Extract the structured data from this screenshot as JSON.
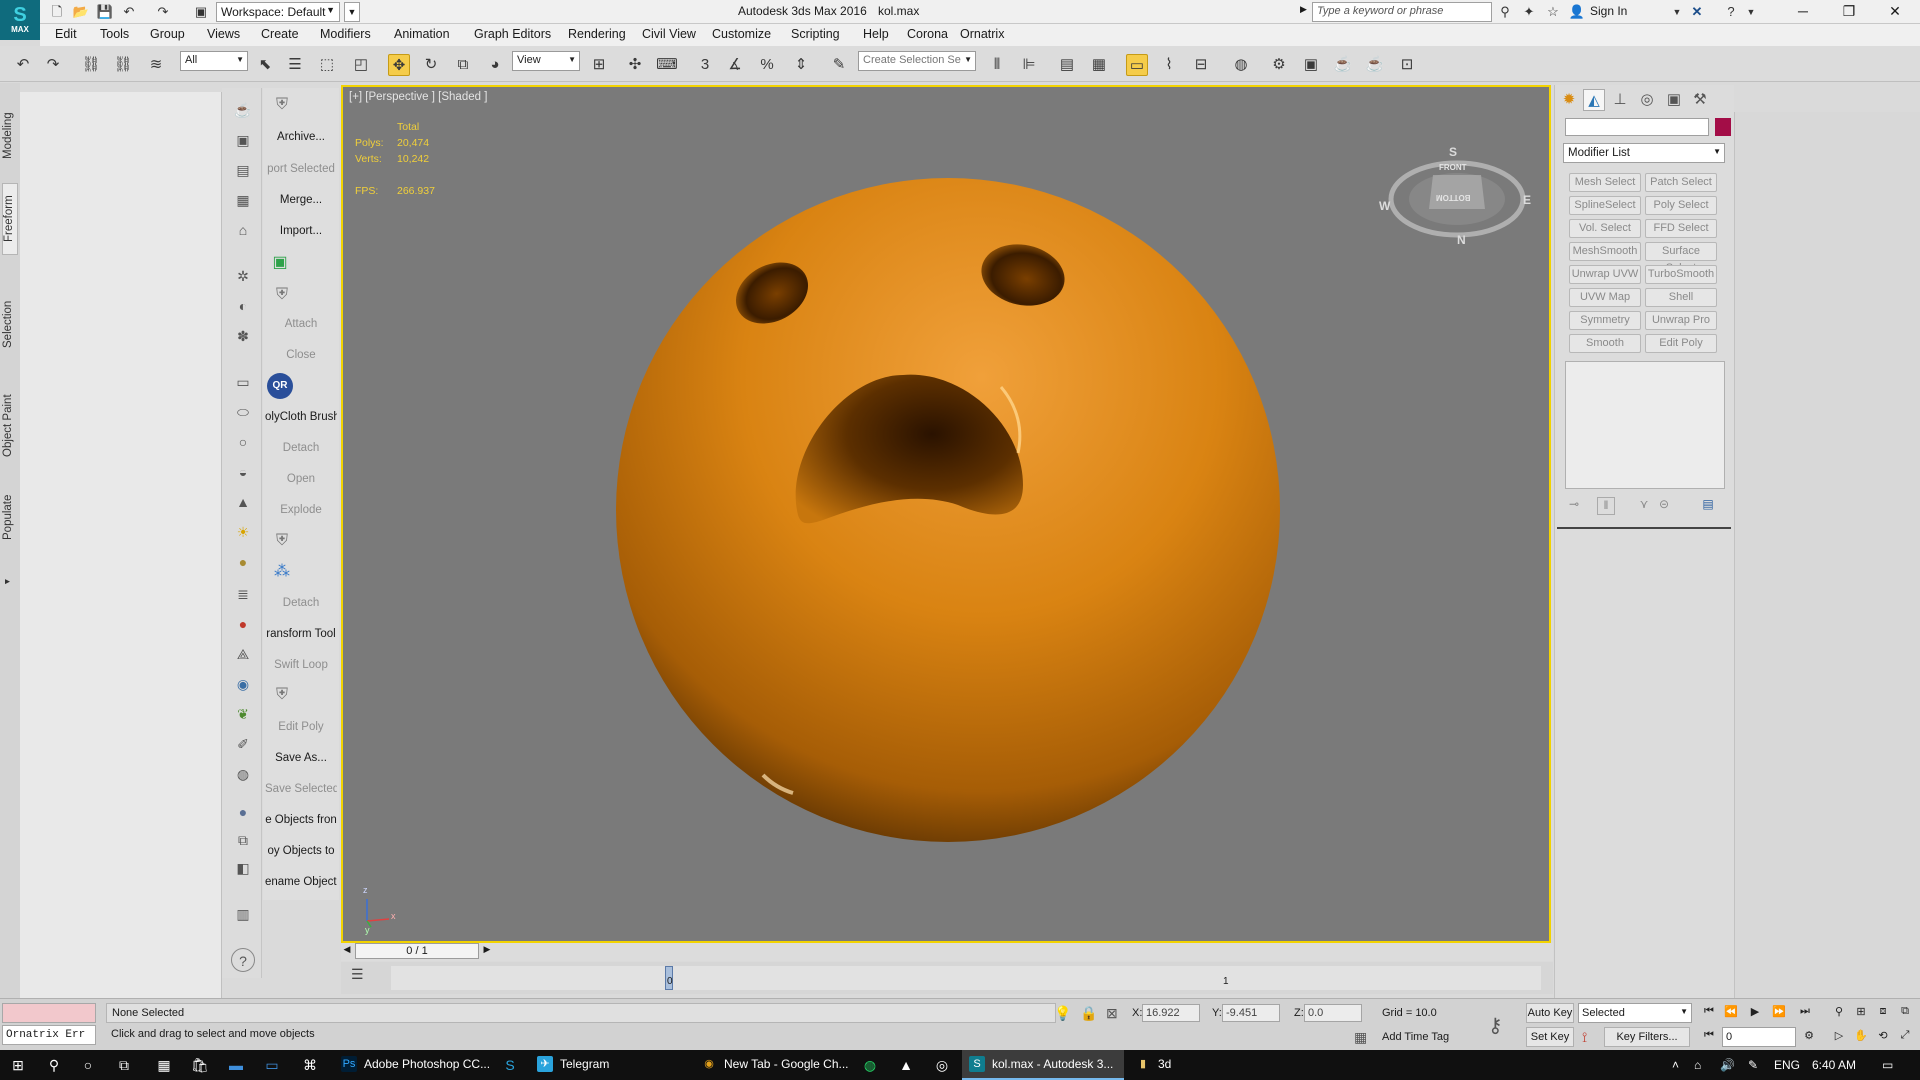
{
  "window": {
    "app_title": "Autodesk 3ds Max 2016",
    "file_name": "kol.max",
    "workspace": "Workspace: Default",
    "search_placeholder": "Type a keyword or phrase",
    "sign_in": "Sign In",
    "logo_letter": "S",
    "logo_sub": "MAX"
  },
  "menu": [
    "Edit",
    "Tools",
    "Group",
    "Views",
    "Create",
    "Modifiers",
    "Animation",
    "Graph Editors",
    "Rendering",
    "Civil View",
    "Customize",
    "Scripting",
    "Help",
    "Corona",
    "Ornatrix"
  ],
  "toolbar": {
    "filter_value": "All",
    "refcoord_value": "View",
    "named_selection_placeholder": "Create Selection Se",
    "snap_label": "3"
  },
  "side_tabs": [
    "Modeling",
    "Freeform",
    "Selection",
    "Object Paint",
    "Populate"
  ],
  "command_items": [
    {
      "label": "Archive...",
      "disabled": false
    },
    {
      "label": "port Selected",
      "disabled": true
    },
    {
      "label": "Merge...",
      "disabled": false
    },
    {
      "label": "Import...",
      "disabled": false
    },
    {
      "label": "Attach",
      "disabled": true
    },
    {
      "label": "Close",
      "disabled": true
    },
    {
      "label": "olyCloth Brush",
      "disabled": false
    },
    {
      "label": "Detach",
      "disabled": true
    },
    {
      "label": "Open",
      "disabled": true
    },
    {
      "label": "Explode",
      "disabled": true
    },
    {
      "label": "Detach",
      "disabled": true
    },
    {
      "label": "ransform Tool",
      "disabled": false
    },
    {
      "label": "Swift Loop",
      "disabled": true
    },
    {
      "label": "Edit Poly",
      "disabled": true
    },
    {
      "label": "Save As...",
      "disabled": false
    },
    {
      "label": "Save Selected",
      "disabled": true
    },
    {
      "label": "e Objects fron",
      "disabled": false
    },
    {
      "label": "oy Objects to",
      "disabled": false
    },
    {
      "label": "ename Objects",
      "disabled": false
    }
  ],
  "command_icon_qr": "QR",
  "viewport": {
    "label": "[+] [Perspective ] [Shaded ]",
    "stats_header": "Total",
    "polys_label": "Polys:",
    "polys_value": "20,474",
    "verts_label": "Verts:",
    "verts_value": "10,242",
    "fps_label": "FPS:",
    "fps_value": "266.937",
    "viewcube_front": "FRONT",
    "viewcube_bottom": "BOTTOM",
    "compass_s": "S",
    "compass_w": "W",
    "compass_e": "E",
    "compass_n": "N",
    "axis_z": "z",
    "axis_x": "x",
    "axis_y": "y",
    "sphere_color": "#d9820e"
  },
  "command_panel": {
    "modifier_list": "Modifier List",
    "object_color": "#a30d47",
    "modifier_buttons": [
      "Mesh Select",
      "Patch Select",
      "SplineSelect",
      "Poly Select",
      "Vol. Select",
      "FFD Select",
      "MeshSmooth",
      "Surface Select",
      "Unwrap UVW",
      "TurboSmooth",
      "UVW Map",
      "Shell",
      "Symmetry",
      "Unwrap Pro",
      "Smooth",
      "Edit Poly"
    ]
  },
  "timeline": {
    "frame_display": "0 / 1",
    "tick_0": "0",
    "tick_1": "1"
  },
  "status": {
    "listener_text": "Ornatrix Err",
    "selection": "None Selected",
    "prompt": "Click and drag to select and move objects",
    "x_label": "X:",
    "x_value": "16.922",
    "y_label": "Y:",
    "y_value": "-9.451",
    "z_label": "Z:",
    "z_value": "0.0",
    "grid": "Grid = 10.0",
    "add_time_tag": "Add Time Tag",
    "auto_key": "Auto Key",
    "set_key": "Set Key",
    "selected_dd": "Selected",
    "key_filters": "Key Filters...",
    "current_frame": "0"
  },
  "taskbar": {
    "apps": [
      {
        "label": "Adobe Photoshop CC...",
        "icon": "Ps",
        "color": "#001d34"
      },
      {
        "label": "Telegram",
        "icon": "✈",
        "color": "#2aa3dc"
      },
      {
        "label": "New Tab - Google Ch...",
        "icon": "◉",
        "color": "#e4a11b"
      },
      {
        "label": "kol.max - Autodesk 3...",
        "icon": "S",
        "color": "#0f7d8f"
      },
      {
        "label": "3d",
        "icon": "▮",
        "color": "#e7c46a"
      }
    ],
    "lang": "ENG",
    "time": "6:40 AM"
  }
}
